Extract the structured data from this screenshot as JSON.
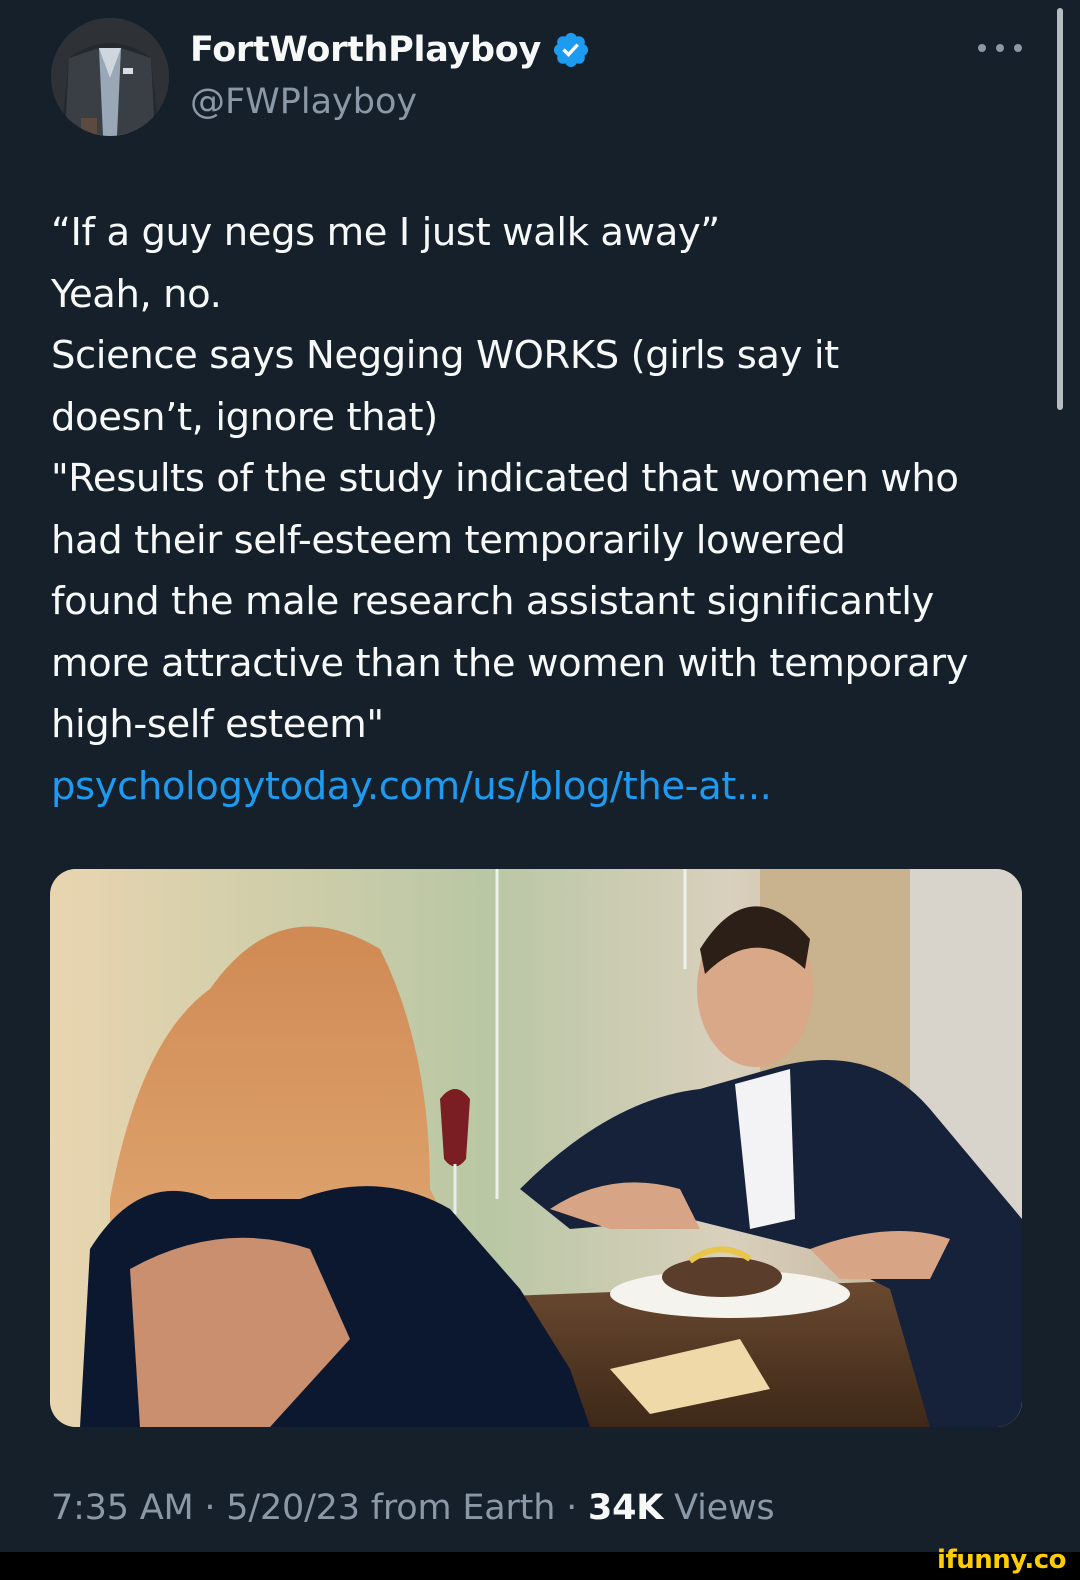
{
  "tweet": {
    "display_name": "FortWorthPlayboy",
    "handle": "@FWPlayboy",
    "verified_icon": "verified-badge-icon",
    "more_icon": "more-options-icon",
    "lines": [
      "“If a guy negs me I just walk away”",
      "Yeah, no.",
      "Science says Negging WORKS (girls say it",
      "doesn’t, ignore that)",
      "\"Results of the study indicated that women who",
      "had their self-esteem temporarily lowered",
      "found the male research assistant significantly",
      "more attractive than the women with temporary",
      "high-self esteem\""
    ],
    "link": "psychologytoday.com/us/blog/the-at...",
    "time": "7:35 AM",
    "separator": "·",
    "date": "5/20/23",
    "source": "from Earth",
    "views_count": "34K",
    "views_label": "Views"
  },
  "watermark": "ifunny.co",
  "colors": {
    "background": "#15202b",
    "text": "#f7f9f9",
    "secondary": "#8b98a5",
    "link": "#1d9bf0",
    "verified": "#1d9bf0",
    "watermark": "#ffcc00"
  }
}
